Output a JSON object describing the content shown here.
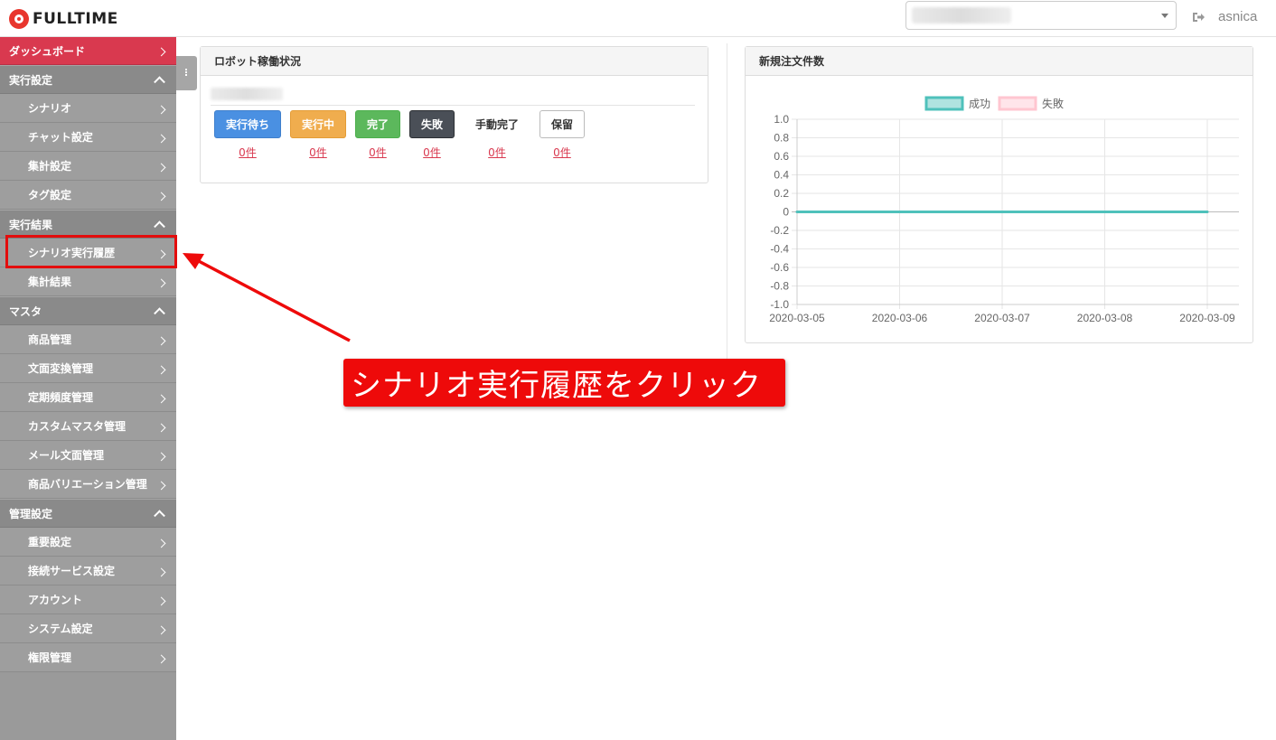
{
  "header": {
    "logo_text": "FULLTIME",
    "username": "asnica",
    "org_select_value": ""
  },
  "sidebar": {
    "dashboard": "ダッシュボード",
    "sections": [
      {
        "title": "実行設定",
        "items": [
          "シナリオ",
          "チャット設定",
          "集計設定",
          "タグ設定"
        ]
      },
      {
        "title": "実行結果",
        "items": [
          "シナリオ実行履歴",
          "集計結果"
        ]
      },
      {
        "title": "マスタ",
        "items": [
          "商品管理",
          "文面変換管理",
          "定期頻度管理",
          "カスタムマスタ管理",
          "メール文面管理",
          "商品バリエーション管理"
        ]
      },
      {
        "title": "管理設定",
        "items": [
          "重要設定",
          "接続サービス設定",
          "アカウント",
          "システム設定",
          "権限管理"
        ]
      }
    ]
  },
  "robot_panel": {
    "title": "ロボット稼働状況",
    "statuses": [
      {
        "label": "実行待ち",
        "count": "0件"
      },
      {
        "label": "実行中",
        "count": "0件"
      },
      {
        "label": "完了",
        "count": "0件"
      },
      {
        "label": "失敗",
        "count": "0件"
      },
      {
        "label": "手動完了",
        "count": "0件"
      },
      {
        "label": "保留",
        "count": "0件"
      }
    ]
  },
  "orders_panel": {
    "title": "新規注文件数"
  },
  "chart_data": {
    "type": "line",
    "x": [
      "2020-03-05",
      "2020-03-06",
      "2020-03-07",
      "2020-03-08",
      "2020-03-09"
    ],
    "series": [
      {
        "name": "成功",
        "values": [
          0,
          0,
          0,
          0,
          0
        ],
        "color": "#4fc1bb"
      },
      {
        "name": "失敗",
        "values": [
          0,
          0,
          0,
          0,
          0
        ],
        "color": "#ffc6d0"
      }
    ],
    "ylim": [
      -1.0,
      1.0
    ],
    "yticks": [
      "1.0",
      "0.8",
      "0.6",
      "0.4",
      "0.2",
      "0",
      "-0.2",
      "-0.4",
      "-0.6",
      "-0.8",
      "-1.0"
    ],
    "grid": true,
    "legend": "top-center"
  },
  "annotation": {
    "callout_text": "シナリオ実行履歴をクリック",
    "color": "#ee0a0a"
  }
}
